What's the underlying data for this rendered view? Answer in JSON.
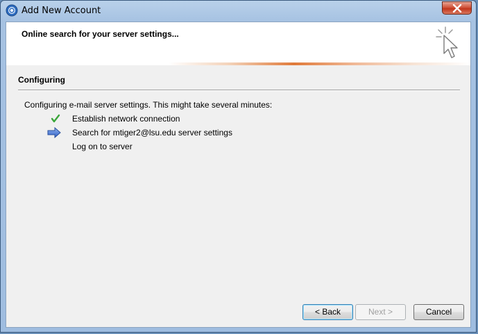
{
  "window": {
    "title": "Add New Account"
  },
  "header": {
    "title": "Online search for your server settings..."
  },
  "section": {
    "title": "Configuring",
    "description": "Configuring e-mail server settings. This might take several minutes:"
  },
  "steps": [
    {
      "label": "Establish network connection",
      "status": "complete",
      "icon": "checkmark-icon"
    },
    {
      "label": "Search for mtiger2@lsu.edu server settings",
      "status": "in-progress",
      "icon": "arrow-right-icon"
    },
    {
      "label": "Log on to server",
      "status": "pending",
      "icon": ""
    }
  ],
  "buttons": {
    "back": "< Back",
    "next": "Next >",
    "cancel": "Cancel"
  },
  "colors": {
    "check": "#3aa63a",
    "arrow": "#3f6fd0",
    "accent_stripe": "#e07a3a"
  }
}
